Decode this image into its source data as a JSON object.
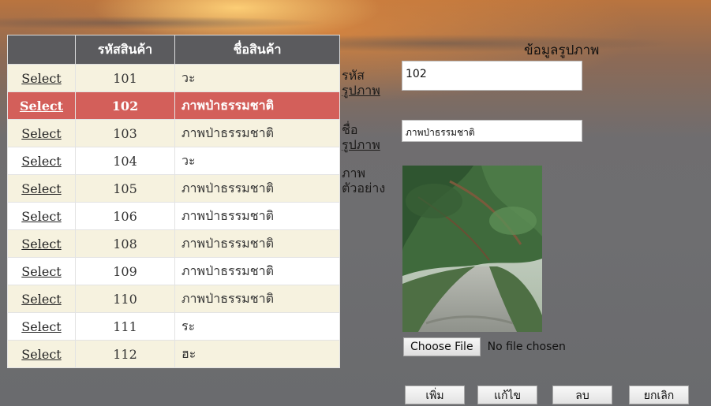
{
  "table": {
    "headers": [
      "",
      "รหัสสินค้า",
      "ชื่อสินค้า"
    ],
    "select_label": "Select",
    "rows": [
      {
        "code": "101",
        "name": "วะ",
        "selected": false
      },
      {
        "code": "102",
        "name": "ภาพป่าธรรมชาติ",
        "selected": true
      },
      {
        "code": "103",
        "name": "ภาพป่าธรรมชาติ",
        "selected": false
      },
      {
        "code": "104",
        "name": "วะ",
        "selected": false
      },
      {
        "code": "105",
        "name": "ภาพป่าธรรมชาติ",
        "selected": false
      },
      {
        "code": "106",
        "name": "ภาพป่าธรรมชาติ",
        "selected": false
      },
      {
        "code": "108",
        "name": "ภาพป่าธรรมชาติ",
        "selected": false
      },
      {
        "code": "109",
        "name": "ภาพป่าธรรมชาติ",
        "selected": false
      },
      {
        "code": "110",
        "name": "ภาพป่าธรรมชาติ",
        "selected": false
      },
      {
        "code": "111",
        "name": "ระ",
        "selected": false
      },
      {
        "code": "112",
        "name": "ฮะ",
        "selected": false
      }
    ]
  },
  "panel": {
    "title": "ข้อมูลรูปภาพ",
    "code_label_1": "รหัส",
    "code_label_2": "รูปภาพ",
    "name_label_1": "ชื่อ",
    "name_label_2": "รูปภาพ",
    "image_label_1": "ภาพ",
    "image_label_2": "ตัวอย่าง",
    "code_value": "102",
    "name_value": "ภาพป่าธรรมชาติ",
    "file_button": "Choose File",
    "file_status": "No file chosen"
  },
  "buttons": {
    "add": "เพิ่ม",
    "edit": "แก้ไข",
    "delete": "ลบ",
    "cancel": "ยกเลิก"
  },
  "colors": {
    "header_bg": "#5b5b5e",
    "selected_row": "#d35f5a",
    "alt_row": "#f6f2df"
  }
}
